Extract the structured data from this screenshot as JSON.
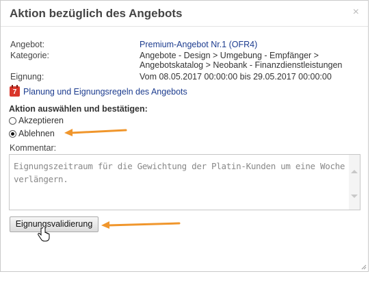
{
  "dialog": {
    "title": "Aktion bezüglich des Angebots",
    "close_label": "×"
  },
  "details": {
    "offer_label": "Angebot:",
    "offer_value": "Premium-Angebot Nr.1 (OFR4)",
    "category_label": "Kategorie:",
    "category_line1": "Angebote - Design > Umgebung - Empfänger >",
    "category_line2": "Angebotskatalog > Neobank - Finanzdienstleistungen",
    "eligibility_label": "Eignung:",
    "eligibility_value": "Vom 08.05.2017 00:00:00 bis 29.05.2017 00:00:00"
  },
  "planning_link": {
    "icon": "calendar-icon",
    "icon_day": "7",
    "label": "Planung und Eignungsregeln des Angebots"
  },
  "action": {
    "heading": "Aktion auswählen und bestätigen:",
    "options": [
      {
        "label": "Akzeptieren",
        "checked": false
      },
      {
        "label": "Ablehnen",
        "checked": true
      }
    ]
  },
  "comment": {
    "label": "Kommentar:",
    "text": "Eignungszeitraum für die Gewichtung der Platin-Kunden um eine Woche verlängern."
  },
  "submit": {
    "label": "Eignungsvalidierung"
  },
  "colors": {
    "link": "#1c3c8f",
    "annotation_arrow": "#f0962c",
    "calendar": "#d9362b"
  }
}
